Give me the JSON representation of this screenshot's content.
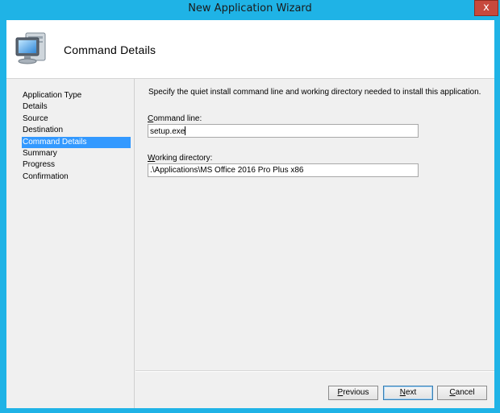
{
  "window": {
    "title": "New Application Wizard",
    "close_glyph": "x"
  },
  "header": {
    "title": "Command Details",
    "icon": "computer-icon"
  },
  "nav": {
    "items": [
      {
        "label": "Application Type",
        "active": false
      },
      {
        "label": "Details",
        "active": false
      },
      {
        "label": "Source",
        "active": false
      },
      {
        "label": "Destination",
        "active": false
      },
      {
        "label": "Command Details",
        "active": true
      },
      {
        "label": "Summary",
        "active": false
      },
      {
        "label": "Progress",
        "active": false
      },
      {
        "label": "Confirmation",
        "active": false
      }
    ]
  },
  "main": {
    "instruction": "Specify the quiet install command line and working directory needed to install this application.",
    "command_line": {
      "label_first": "C",
      "label_rest": "ommand line:",
      "value": "setup.exe"
    },
    "working_directory": {
      "label_first": "W",
      "label_rest": "orking directory:",
      "value": ".\\Applications\\MS Office 2016 Pro Plus x86"
    }
  },
  "buttons": {
    "previous": {
      "first": "P",
      "rest": "revious"
    },
    "next": {
      "first": "N",
      "rest": "ext"
    },
    "cancel": {
      "first": "C",
      "rest": "ancel"
    }
  },
  "colors": {
    "frame": "#1fb3e6",
    "selection": "#3399ff",
    "close": "#c7493d"
  }
}
